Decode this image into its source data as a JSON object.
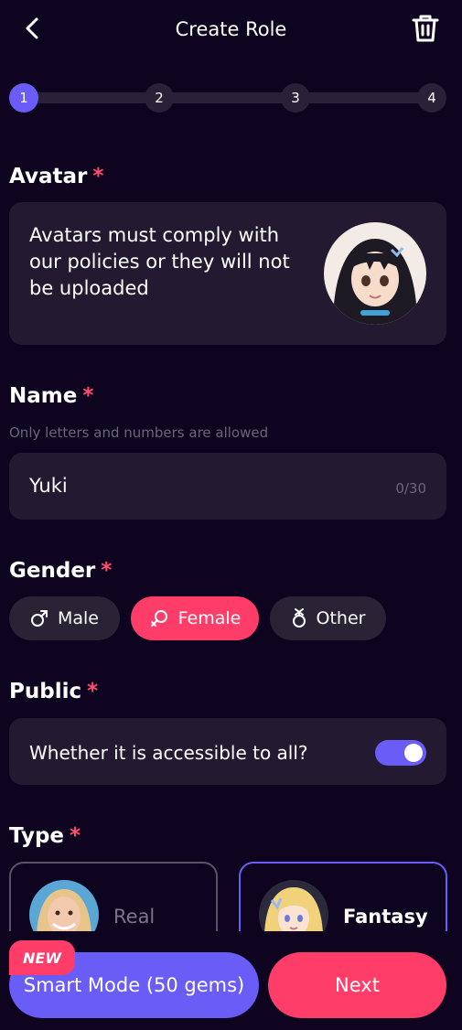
{
  "header": {
    "title": "Create Role",
    "back_icon": "chevron-left-icon",
    "delete_icon": "trash-icon"
  },
  "stepper": {
    "steps": [
      "1",
      "2",
      "3",
      "4"
    ],
    "active_step": 1
  },
  "avatar": {
    "label": "Avatar",
    "required_mark": "*",
    "description": "Avatars must comply with our policies or they will not be uploaded"
  },
  "name": {
    "label": "Name",
    "required_mark": "*",
    "hint": "Only letters and numbers are allowed",
    "value": "Yuki",
    "counter": "0/30"
  },
  "gender": {
    "label": "Gender",
    "required_mark": "*",
    "options": [
      {
        "label": "Male",
        "icon": "male-icon",
        "selected": false
      },
      {
        "label": "Female",
        "icon": "female-icon",
        "selected": true
      },
      {
        "label": "Other",
        "icon": "other-gender-icon",
        "selected": false
      }
    ]
  },
  "public": {
    "label": "Public",
    "required_mark": "*",
    "question": "Whether it is accessible to all?",
    "enabled": true
  },
  "type": {
    "label": "Type",
    "required_mark": "*",
    "options": [
      {
        "label": "Real",
        "selected": false
      },
      {
        "label": "Fantasy",
        "selected": true
      }
    ]
  },
  "footer": {
    "badge": "NEW",
    "smart_mode_label": "Smart Mode (50 gems)",
    "next_label": "Next"
  },
  "colors": {
    "background": "#0f0420",
    "card": "#231a32",
    "accent_purple": "#6a5cf6",
    "accent_pink": "#ff3d68"
  }
}
